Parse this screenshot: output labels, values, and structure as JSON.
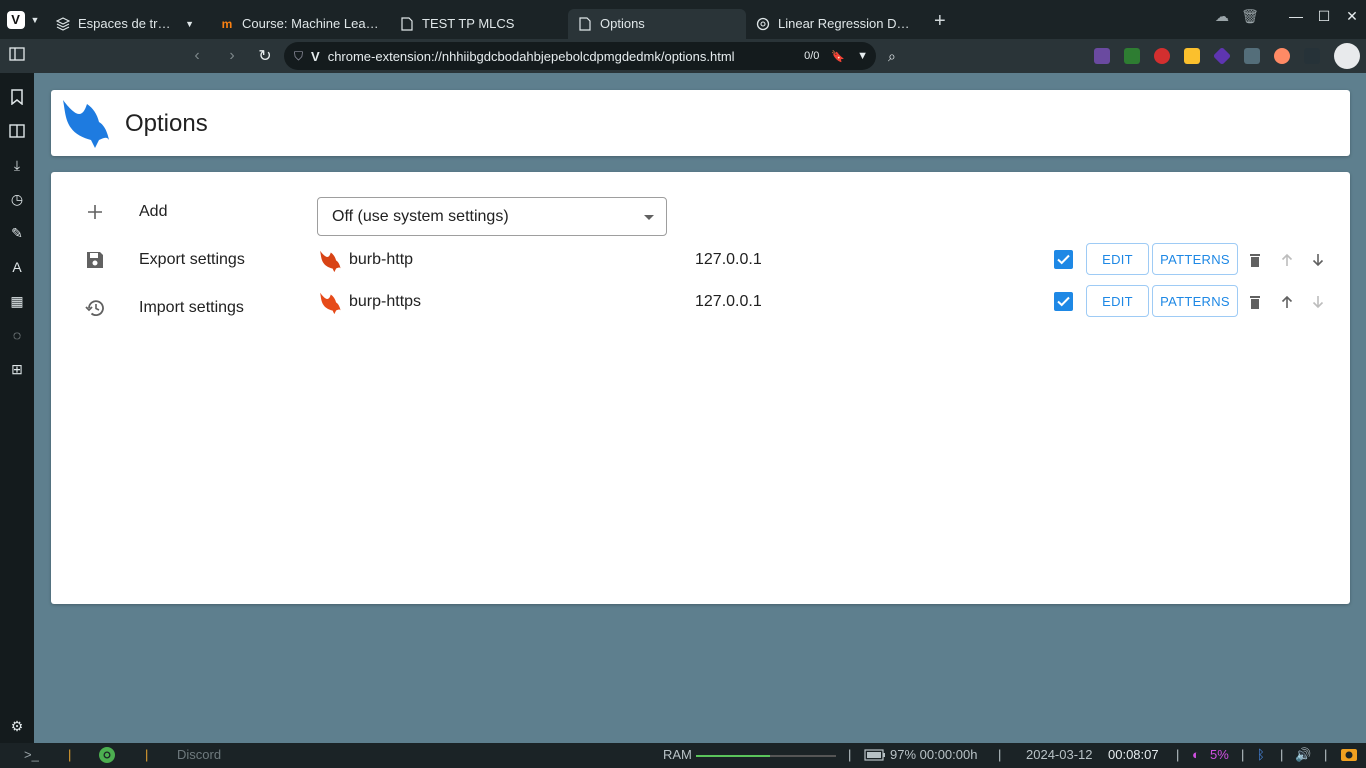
{
  "browser": {
    "tabs": [
      {
        "label": "Espaces de trav...",
        "icon": "stack-icon",
        "active": false
      },
      {
        "label": "Course: Machine Learni...",
        "icon": "moodle-icon",
        "active": false
      },
      {
        "label": "TEST TP MLCS",
        "icon": "doc-icon",
        "active": false
      },
      {
        "label": "Options",
        "icon": "doc-icon",
        "active": true
      },
      {
        "label": "Linear Regression Data ...",
        "icon": "openai-icon",
        "active": false
      }
    ],
    "url": "chrome-extension://nhhiibgdcbodahbjepebolcdpmgdedmk/options.html",
    "find_count": "0/0"
  },
  "page": {
    "title": "Options",
    "menu": [
      {
        "label": "Add",
        "icon": "plus-icon"
      },
      {
        "label": "Export settings",
        "icon": "save-icon"
      },
      {
        "label": "Import settings",
        "icon": "history-icon"
      }
    ],
    "mode_select": {
      "value": "Off (use system settings)"
    },
    "proxies": [
      {
        "name": "burb-http",
        "host": "127.0.0.1",
        "enabled": true,
        "edit": "EDIT",
        "patterns": "PATTERNS",
        "color": "#d84315"
      },
      {
        "name": "burp-https",
        "host": "127.0.0.1",
        "enabled": true,
        "edit": "EDIT",
        "patterns": "PATTERNS",
        "color": "#e64a19"
      }
    ]
  },
  "statusbar": {
    "terminal": ">_",
    "app": "Discord",
    "ram_label": "RAM",
    "ram_fraction": 0.53,
    "battery": "97% 00:00:00h",
    "date": "2024-03-12",
    "time": "00:08:07",
    "cpu": "5%"
  }
}
